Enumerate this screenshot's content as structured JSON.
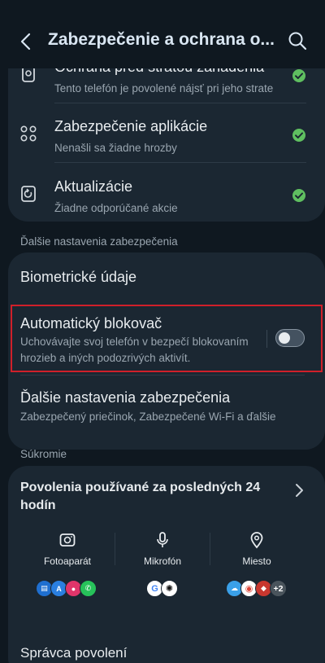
{
  "header": {
    "title": "Zabezpečenie a ochrana o..."
  },
  "security_checks": [
    {
      "title": "Ochrana pred stratou zariadenia",
      "subtitle": "Tento telefón je povolené nájsť pri jeho strate",
      "icon": "lost-device-icon"
    },
    {
      "title": "Zabezpečenie aplikácie",
      "subtitle": "Nenašli sa žiadne hrozby",
      "icon": "app-security-icon"
    },
    {
      "title": "Aktualizácie",
      "subtitle": "Žiadne odporúčané akcie",
      "icon": "update-icon"
    }
  ],
  "more_security": {
    "label": "Ďalšie nastavenia zabezpečenia",
    "items": [
      {
        "title": "Biometrické údaje"
      },
      {
        "title": "Automatický blokovač",
        "subtitle": "Uchovávajte svoj telefón v bezpečí blokovaním hrozieb a iných podozrivých aktivít.",
        "toggle": false
      },
      {
        "title": "Ďalšie nastavenia zabezpečenia",
        "subtitle": "Zabezpečený priečinok, Zabezpečené Wi-Fi a ďalšie"
      }
    ]
  },
  "privacy": {
    "label": "Súkromie",
    "permissions_title": "Povolenia používané za posledných 24 hodín",
    "columns": [
      {
        "label": "Fotoaparát",
        "icon": "camera-icon",
        "apps": [
          "bank-app-icon",
          "adobe-acrobat-icon",
          "camera-app-icon",
          "whatsapp-icon"
        ]
      },
      {
        "label": "Mikrofón",
        "icon": "microphone-icon",
        "apps": [
          "google-icon",
          "chatgpt-icon"
        ]
      },
      {
        "label": "Miesto",
        "icon": "location-icon",
        "apps": [
          "weather-icon",
          "chrome-icon",
          "shield-app-icon"
        ],
        "more": "+2"
      }
    ],
    "manager": "Správca povolení"
  },
  "colors": {
    "background": "#0f1820",
    "card": "#1b2732",
    "accent_check": "#5fbf60",
    "highlight": "#d0202a"
  }
}
